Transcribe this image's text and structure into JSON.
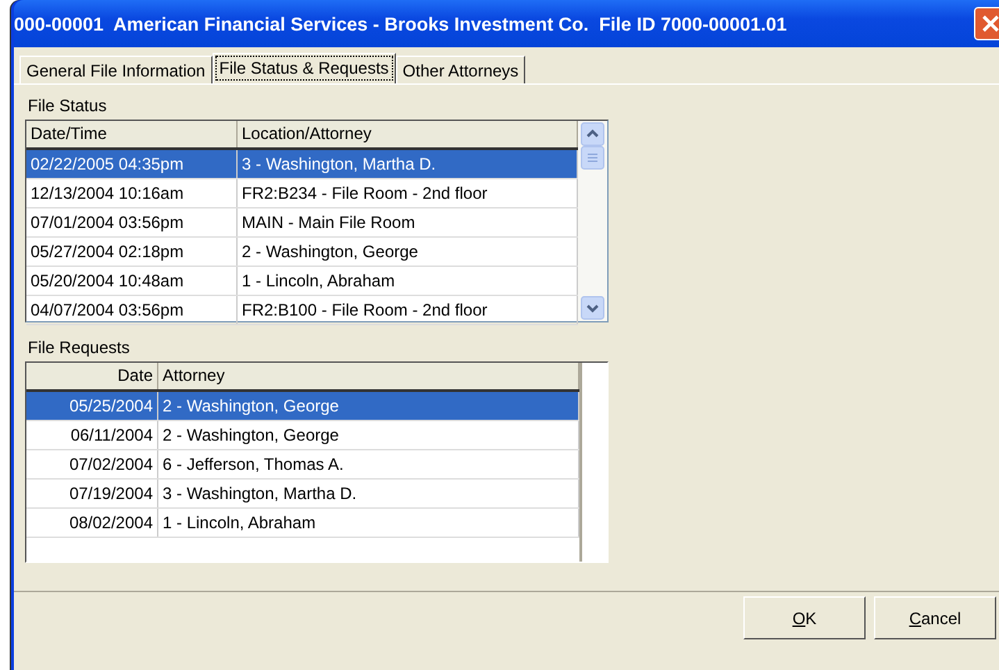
{
  "window": {
    "title": "000-00001  American Financial Services - Brooks Investment Co.  File ID 7000-00001.01"
  },
  "tabs": [
    {
      "label": "General File Information",
      "selected": false
    },
    {
      "label": "File Status & Requests",
      "selected": true
    },
    {
      "label": "Other Attorneys",
      "selected": false
    }
  ],
  "file_status": {
    "label": "File Status",
    "columns": [
      "Date/Time",
      "Location/Attorney"
    ],
    "rows": [
      {
        "cells": [
          "02/22/2005 04:35pm",
          "3 - Washington, Martha D."
        ],
        "selected": true
      },
      {
        "cells": [
          "12/13/2004 10:16am",
          "FR2:B234 - File Room - 2nd floor"
        ],
        "selected": false
      },
      {
        "cells": [
          "07/01/2004 03:56pm",
          "MAIN - Main File Room"
        ],
        "selected": false
      },
      {
        "cells": [
          "05/27/2004 02:18pm",
          "2 - Washington, George"
        ],
        "selected": false
      },
      {
        "cells": [
          "05/20/2004 10:48am",
          "1 - Lincoln, Abraham"
        ],
        "selected": false
      },
      {
        "cells": [
          "04/07/2004 03:56pm",
          "FR2:B100 - File Room - 2nd floor"
        ],
        "selected": false
      }
    ]
  },
  "file_requests": {
    "label": "File Requests",
    "columns": [
      "Date",
      "Attorney"
    ],
    "rows": [
      {
        "cells": [
          "05/25/2004",
          "2 - Washington, George"
        ],
        "selected": true
      },
      {
        "cells": [
          "06/11/2004",
          "2 - Washington, George"
        ],
        "selected": false
      },
      {
        "cells": [
          "07/02/2004",
          "6 - Jefferson, Thomas A."
        ],
        "selected": false
      },
      {
        "cells": [
          "07/19/2004",
          "3 - Washington, Martha D."
        ],
        "selected": false
      },
      {
        "cells": [
          "08/02/2004",
          "1 - Lincoln, Abraham"
        ],
        "selected": false
      }
    ]
  },
  "buttons": [
    "OK",
    "Cancel"
  ]
}
